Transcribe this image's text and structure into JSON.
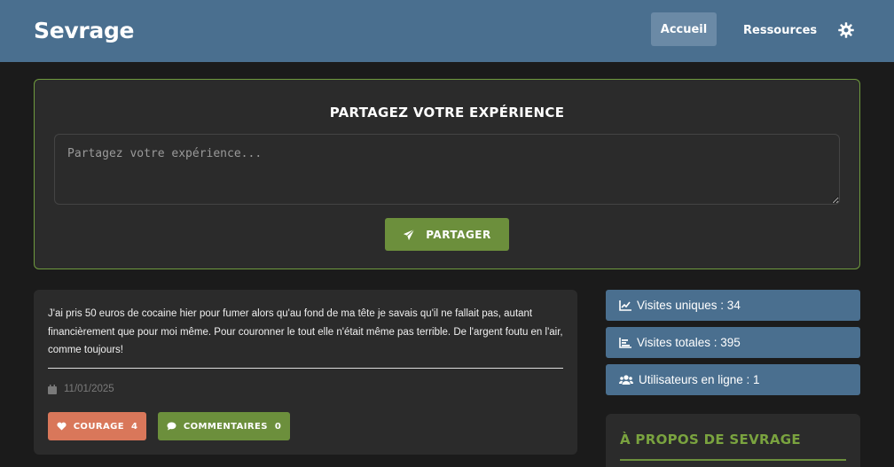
{
  "header": {
    "brand": "Sevrage",
    "nav": [
      {
        "label": "Accueil",
        "active": true
      },
      {
        "label": "Ressources",
        "active": false
      }
    ],
    "theme_icon": "gear-icon"
  },
  "share": {
    "title": "PARTAGEZ VOTRE EXPÉRIENCE",
    "placeholder": "Partagez votre expérience...",
    "value": "",
    "button_label": "PARTAGER",
    "button_icon": "paper-plane-icon"
  },
  "post": {
    "text": "J'ai pris 50 euros de cocaine hier pour fumer alors qu'au fond de ma tête je savais qu'il ne fallait pas, autant financièrement que pour moi même. Pour couronner le tout elle n'était même pas terrible. De l'argent foutu en l'air, comme toujours!",
    "date": "11/01/2025",
    "date_icon": "calendar-icon",
    "courage_label": "COURAGE",
    "courage_count": "4",
    "courage_icon": "heart-icon",
    "comments_label": "COMMENTAIRES",
    "comments_count": "0",
    "comments_icon": "comment-icon"
  },
  "stats": [
    {
      "label": "Visites uniques : 34",
      "icon": "line-chart-icon"
    },
    {
      "label": "Visites totales : 395",
      "icon": "bar-chart-icon"
    },
    {
      "label": "Utilisateurs en ligne : 1",
      "icon": "users-icon"
    }
  ],
  "about": {
    "title": "À PROPOS DE SEVRAGE"
  },
  "colors": {
    "header_bg": "#4a6f8f",
    "page_bg": "#1b1b1b",
    "card_bg": "#2b2b2b",
    "accent_green": "#6c8f3c",
    "accent_orange": "#d9775a"
  }
}
